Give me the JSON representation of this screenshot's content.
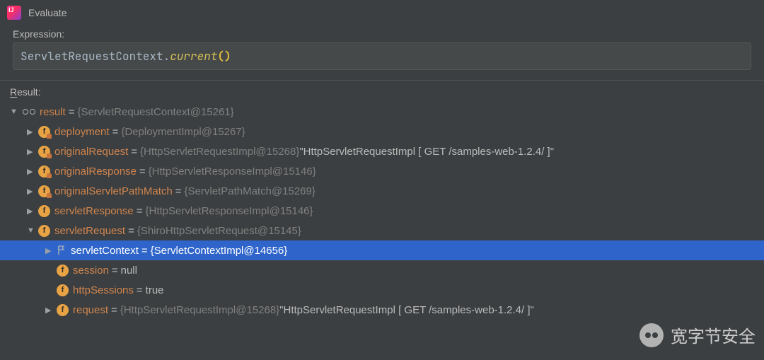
{
  "title": "Evaluate",
  "expression_label": "Expression:",
  "expression": {
    "class_part": "ServletRequestContext",
    "dot": ".",
    "method_part": "current",
    "parens": "()"
  },
  "result_label_pre": "R",
  "result_label_rest": "esult:",
  "tree": {
    "root": {
      "name": "result",
      "value_dim": "{ServletRequestContext@15261}"
    },
    "children": [
      {
        "icon": "flock",
        "name": "deployment",
        "value_dim": "{DeploymentImpl@15267}"
      },
      {
        "icon": "flock",
        "name": "originalRequest",
        "value_dim": "{HttpServletRequestImpl@15268}",
        "tail": " \"HttpServletRequestImpl [ GET /samples-web-1.2.4/ ]\""
      },
      {
        "icon": "flock",
        "name": "originalResponse",
        "value_dim": "{HttpServletResponseImpl@15146}"
      },
      {
        "icon": "flock",
        "name": "originalServletPathMatch",
        "value_dim": "{ServletPathMatch@15269}"
      },
      {
        "icon": "f",
        "name": "servletResponse",
        "value_dim": "{HttpServletResponseImpl@15146}"
      },
      {
        "icon": "f",
        "name": "servletRequest",
        "value_dim": "{ShiroHttpServletRequest@15145}",
        "expanded": true,
        "children": [
          {
            "icon": "flag",
            "name": "servletContext",
            "value_dim": "{ServletContextImpl@14656}",
            "selected": true,
            "has_arrow": true
          },
          {
            "icon": "f",
            "name": "session",
            "literal": "null"
          },
          {
            "icon": "f",
            "name": "httpSessions",
            "literal": "true"
          },
          {
            "icon": "f",
            "name": "request",
            "value_dim": "{HttpServletRequestImpl@15268}",
            "tail": " \"HttpServletRequestImpl [ GET /samples-web-1.2.4/ ]\"",
            "has_arrow": true
          }
        ]
      }
    ]
  },
  "watermark": "宽字节安全"
}
